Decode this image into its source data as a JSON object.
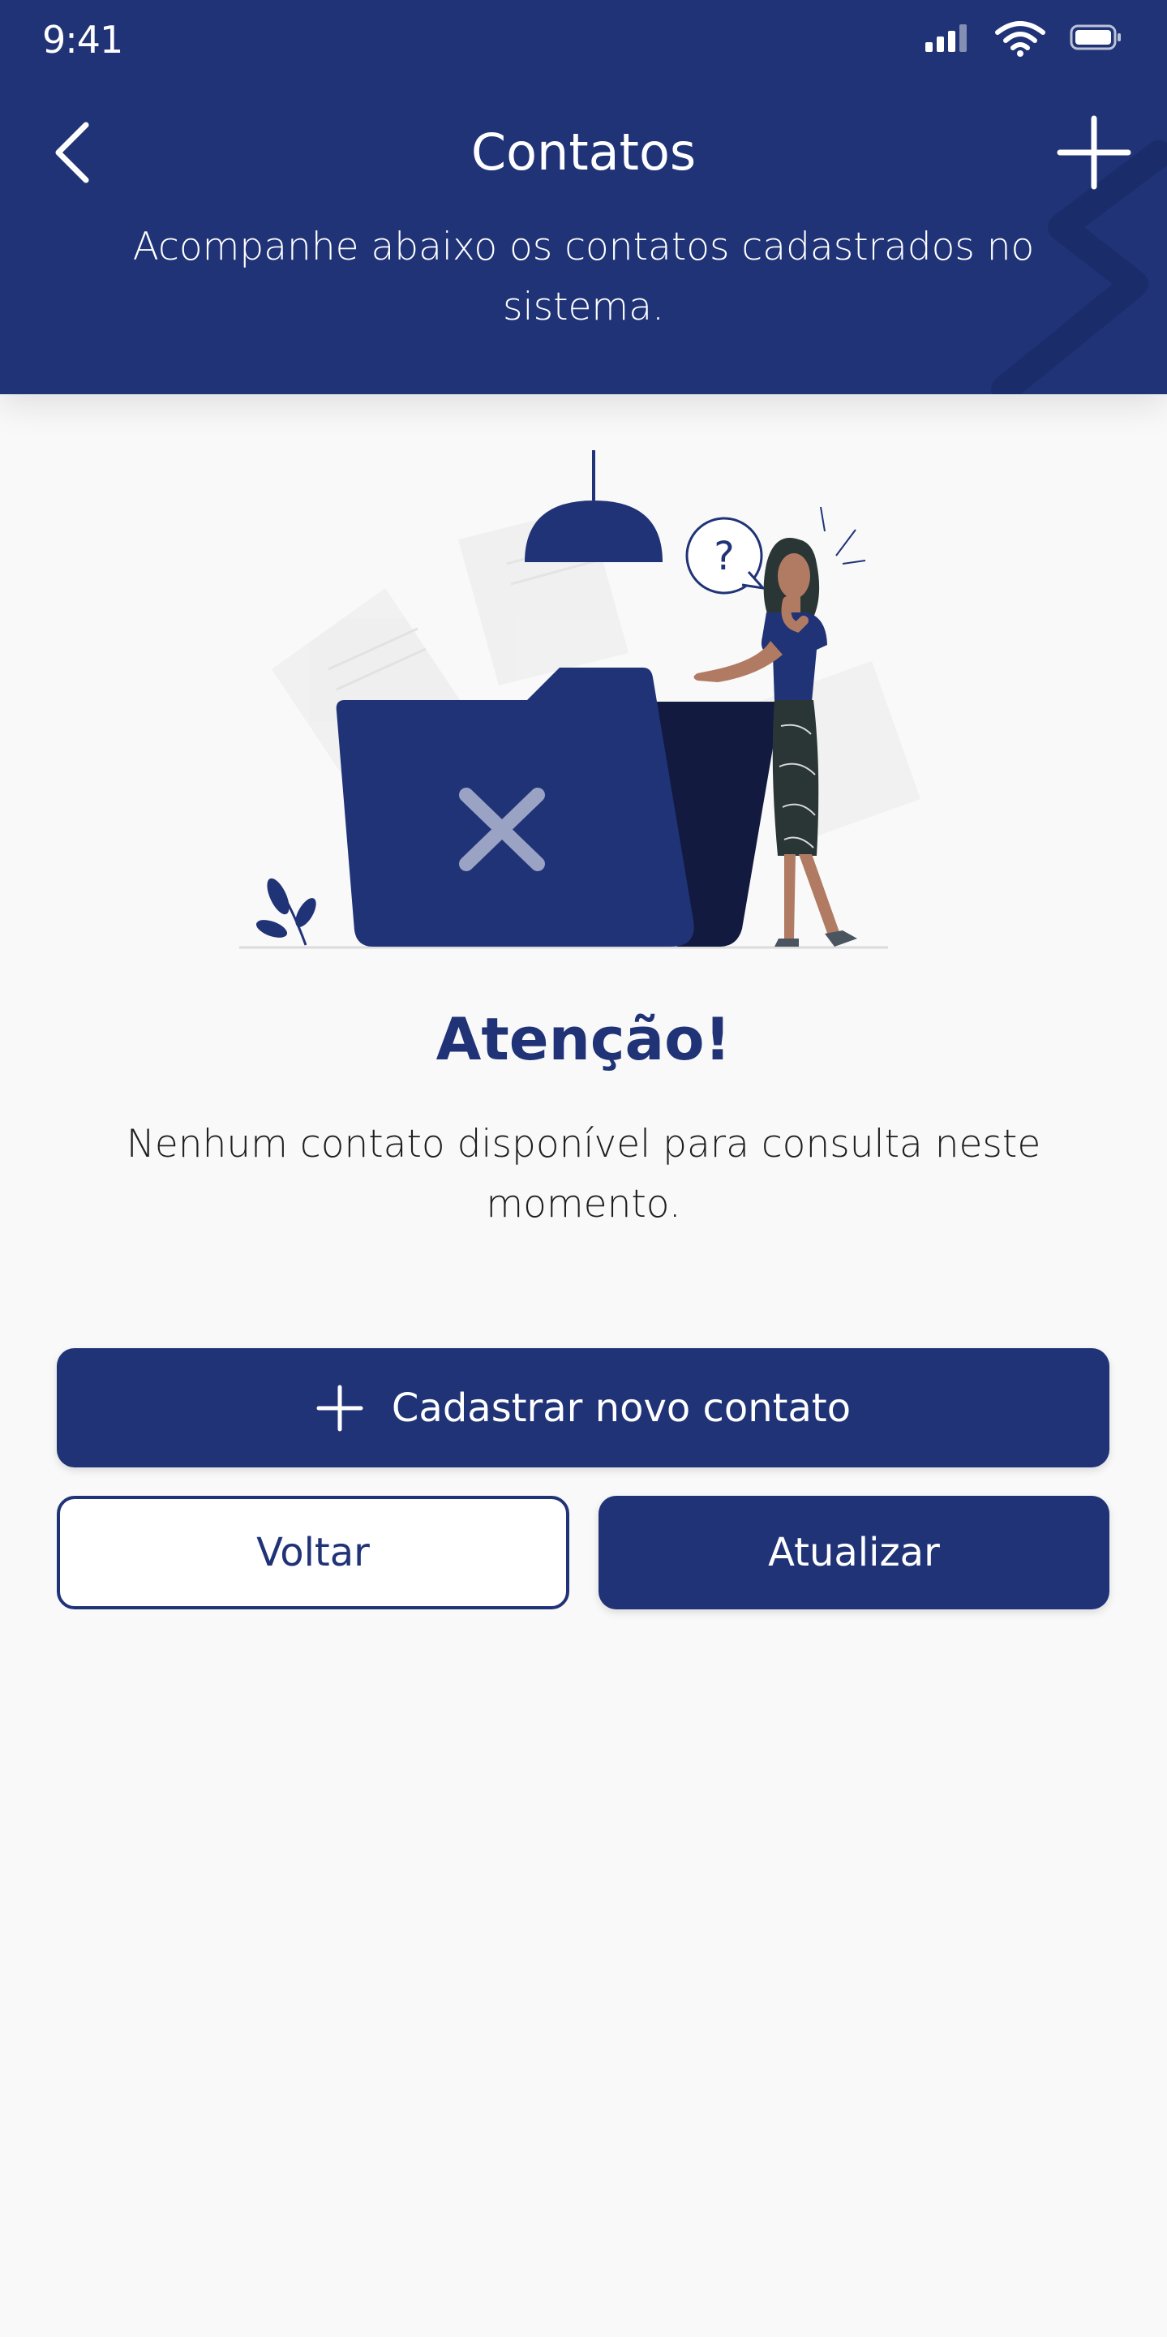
{
  "status_bar": {
    "time": "9:41",
    "icons": [
      "signal-icon",
      "wifi-icon",
      "battery-icon"
    ]
  },
  "header": {
    "title": "Contatos",
    "subtitle": "Acompanhe abaixo os contatos cadastrados no sistema.",
    "back_icon": "chevron-left-icon",
    "add_icon": "plus-icon"
  },
  "empty_state": {
    "illustration": "empty-folder-illustration",
    "title": "Atenção!",
    "message": "Nenhum contato disponível para consulta neste momento."
  },
  "actions": {
    "primary_label": "Cadastrar novo contato",
    "primary_icon": "plus-icon",
    "back_label": "Voltar",
    "refresh_label": "Atualizar"
  },
  "colors": {
    "primary": "#203377",
    "primary_dark": "#121a40",
    "background": "#f9f9f9",
    "skin": "#b07b62"
  }
}
